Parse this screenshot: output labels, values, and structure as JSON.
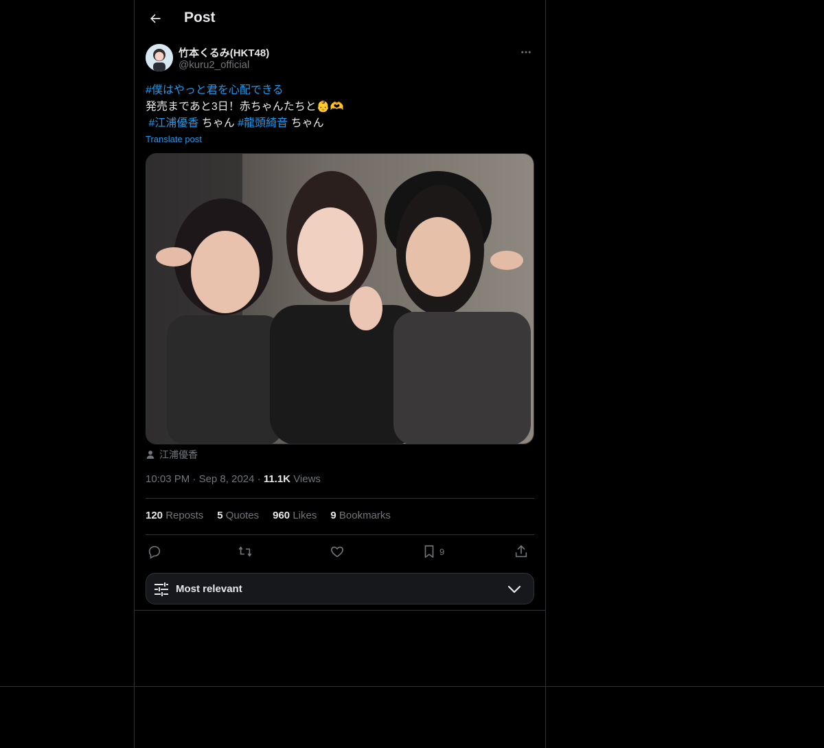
{
  "header": {
    "title": "Post",
    "back_icon": "arrow-left-icon"
  },
  "author": {
    "display_name": "竹本くるみ(HKT48)",
    "handle": "@kuru2_official"
  },
  "post": {
    "hashtag_main": "#僕はやっと君を心配できる",
    "line2": "発売まであと3日！赤ちゃんたちと",
    "line2_emoji": "👶🫶",
    "tag_1": "#江浦優香",
    "suffix_1": " ちゃん ",
    "tag_2": "#龍頭綺音",
    "suffix_2": " ちゃん",
    "translate_label": "Translate post",
    "tagged_person": "江浦優香",
    "time": "10:03 PM",
    "date": "Sep 8, 2024",
    "views_count": "11.1K",
    "views_label": "Views"
  },
  "stats": {
    "reposts_count": "120",
    "reposts_label": "Reposts",
    "quotes_count": "5",
    "quotes_label": "Quotes",
    "likes_count": "960",
    "likes_label": "Likes",
    "bookmarks_count": "9",
    "bookmarks_label": "Bookmarks"
  },
  "actions": {
    "bookmark_count": "9"
  },
  "sort": {
    "label": "Most relevant"
  },
  "colors": {
    "accent": "#1d9bf0",
    "background": "#000000",
    "border": "#2f3336",
    "muted": "#71767b"
  }
}
